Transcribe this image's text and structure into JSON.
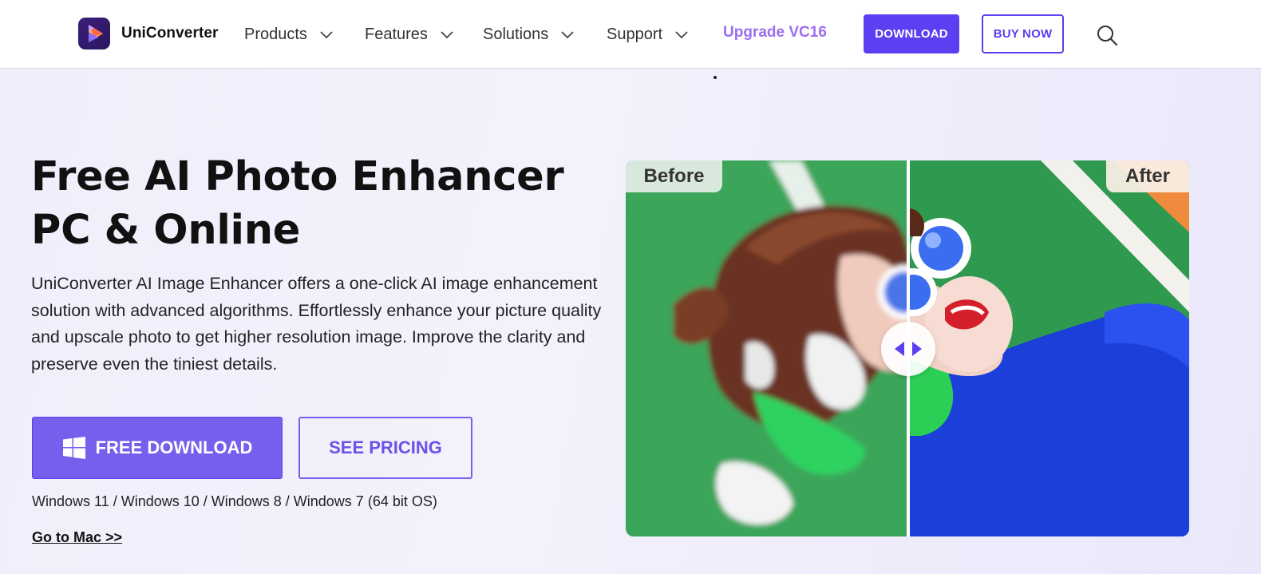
{
  "header": {
    "brand": "UniConverter",
    "nav": [
      {
        "label": "Products"
      },
      {
        "label": "Features"
      },
      {
        "label": "Solutions"
      },
      {
        "label": "Support"
      }
    ],
    "upgrade_label": "Upgrade VC16",
    "download_label": "DOWNLOAD",
    "buy_label": "BUY NOW"
  },
  "hero": {
    "title_line1": "Free AI Photo Enhancer",
    "title_line2": "PC & Online",
    "description": "UniConverter AI Image Enhancer offers a one-click AI image enhancement solution with advanced algorithms. Effortlessly enhance your picture quality and upscale photo to get higher resolution image. Improve the clarity and preserve even the tiniest details.",
    "free_download_label": "FREE DOWNLOAD",
    "see_pricing_label": "SEE PRICING",
    "os_note": "Windows 11 / Windows 10 / Windows 8 / Windows 7 (64 bit OS)",
    "mac_link": "Go to Mac >>"
  },
  "compare": {
    "before_label": "Before",
    "after_label": "After"
  },
  "colors": {
    "accent": "#5b3ff0",
    "accent_light": "#7560ee",
    "upgrade": "#9b6ef0"
  }
}
